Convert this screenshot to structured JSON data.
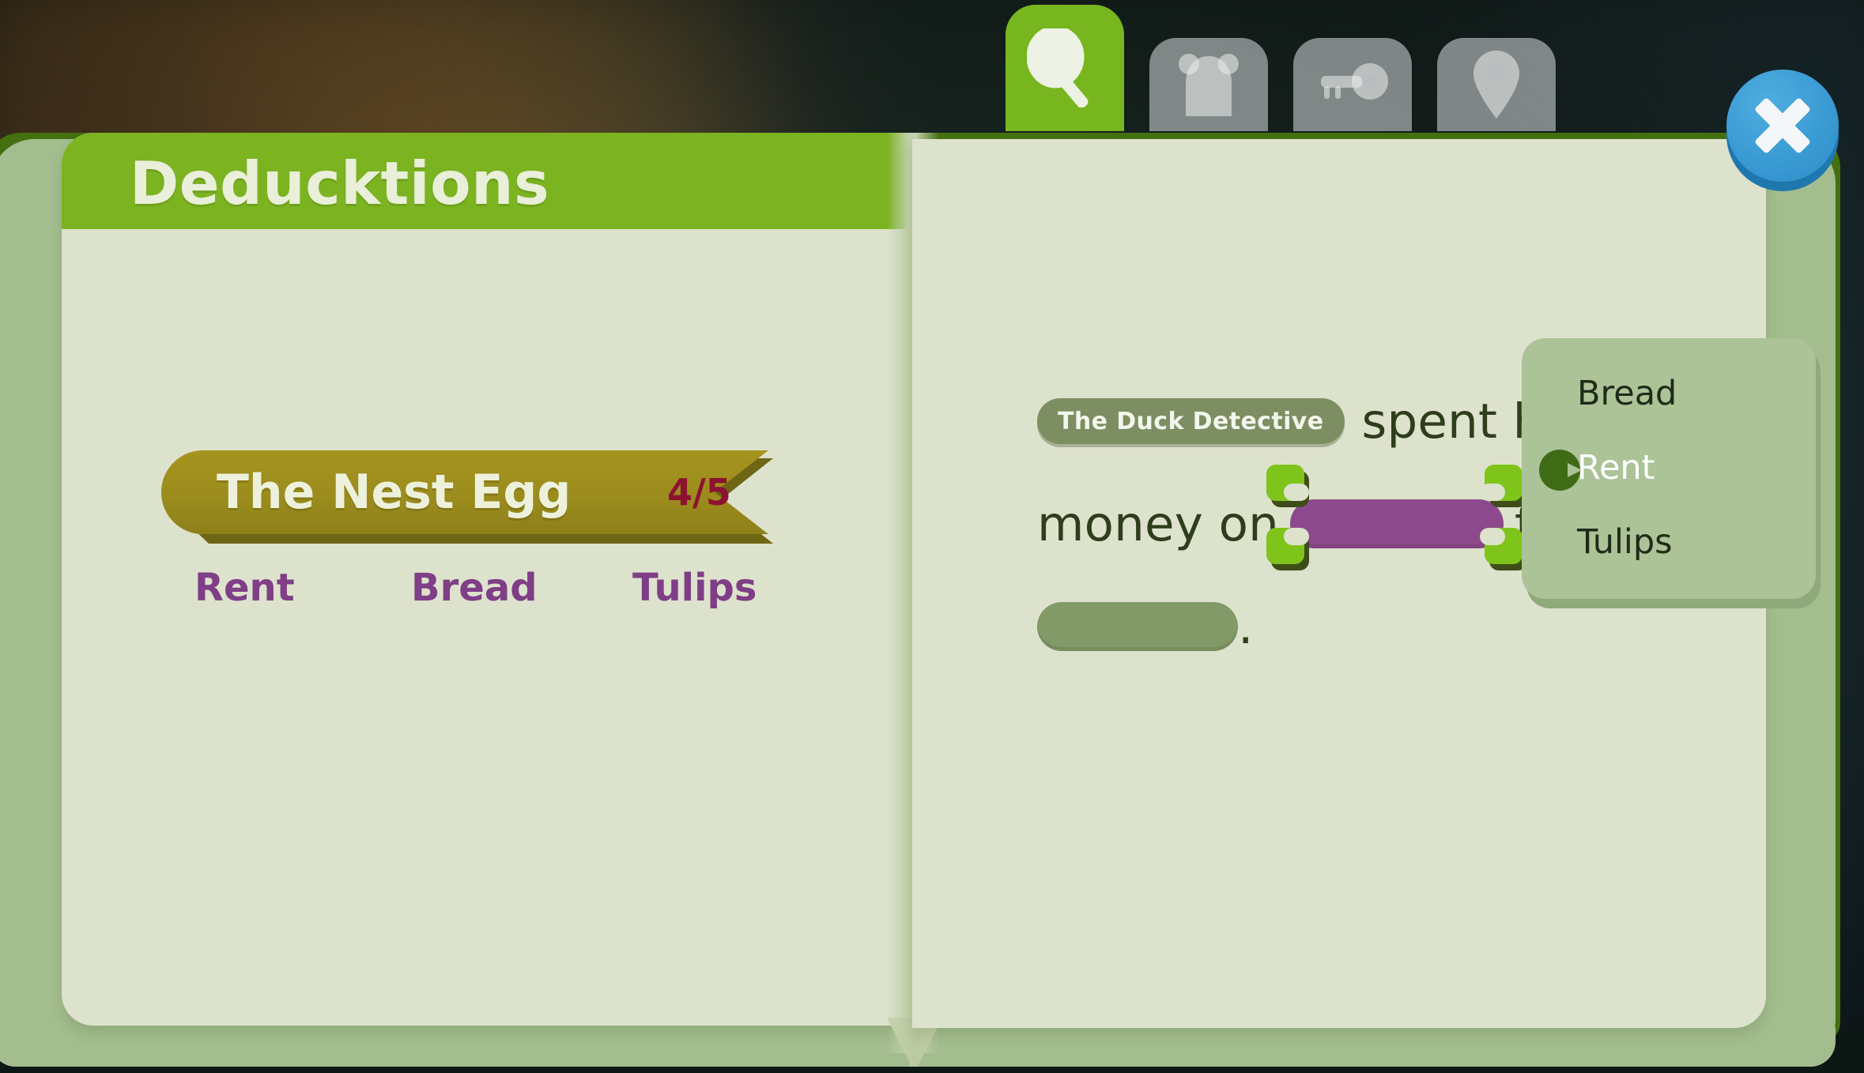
{
  "window": {
    "close_label": "×"
  },
  "tabs": [
    {
      "id": "search",
      "icon": "magnifying-glass-icon",
      "active": true
    },
    {
      "id": "suspects",
      "icon": "bear-icon",
      "active": false
    },
    {
      "id": "evidence",
      "icon": "key-icon",
      "active": false
    },
    {
      "id": "locations",
      "icon": "map-pin-icon",
      "active": false
    }
  ],
  "left_page": {
    "title": "Deducktions",
    "case": {
      "name": "The Nest Egg",
      "progress": "4/5"
    },
    "clue_words": [
      "Rent",
      "Bread",
      "Tulips"
    ]
  },
  "right_page": {
    "speaker": "The Duck Detective",
    "line1_text": "spent his/her last",
    "line2_prefix": "money on",
    "line2_suffix": "f",
    "line3_suffix": ".",
    "blank1_state": "filled",
    "blank2_state": "empty"
  },
  "dropdown": {
    "options": [
      "Bread",
      "Rent",
      "Tulips"
    ],
    "selected": "Rent",
    "selected_index": 1,
    "cursor_icon": "duck-bill-cursor-icon"
  },
  "colors": {
    "header_green": "#7bb321",
    "page_cream": "#dde2cd",
    "page_edge_green": "#a3bd8e",
    "cover_green": "#457011",
    "ribbon_gold": "#9a8b1d",
    "ribbon_title": "#edf1dc",
    "counter_crimson": "#8d1232",
    "clue_purple": "#7f3e86",
    "speaker_pill": "#7d8e62",
    "body_text": "#2e3d1c",
    "blank_filled_purple": "#8c4a8c",
    "blank_empty_green": "#829a67",
    "dropdown_bg": "#abc396",
    "selection_bracket": "#7fc41b",
    "close_blue": "#3a9bd4",
    "tab_active_green": "#77b61e"
  }
}
